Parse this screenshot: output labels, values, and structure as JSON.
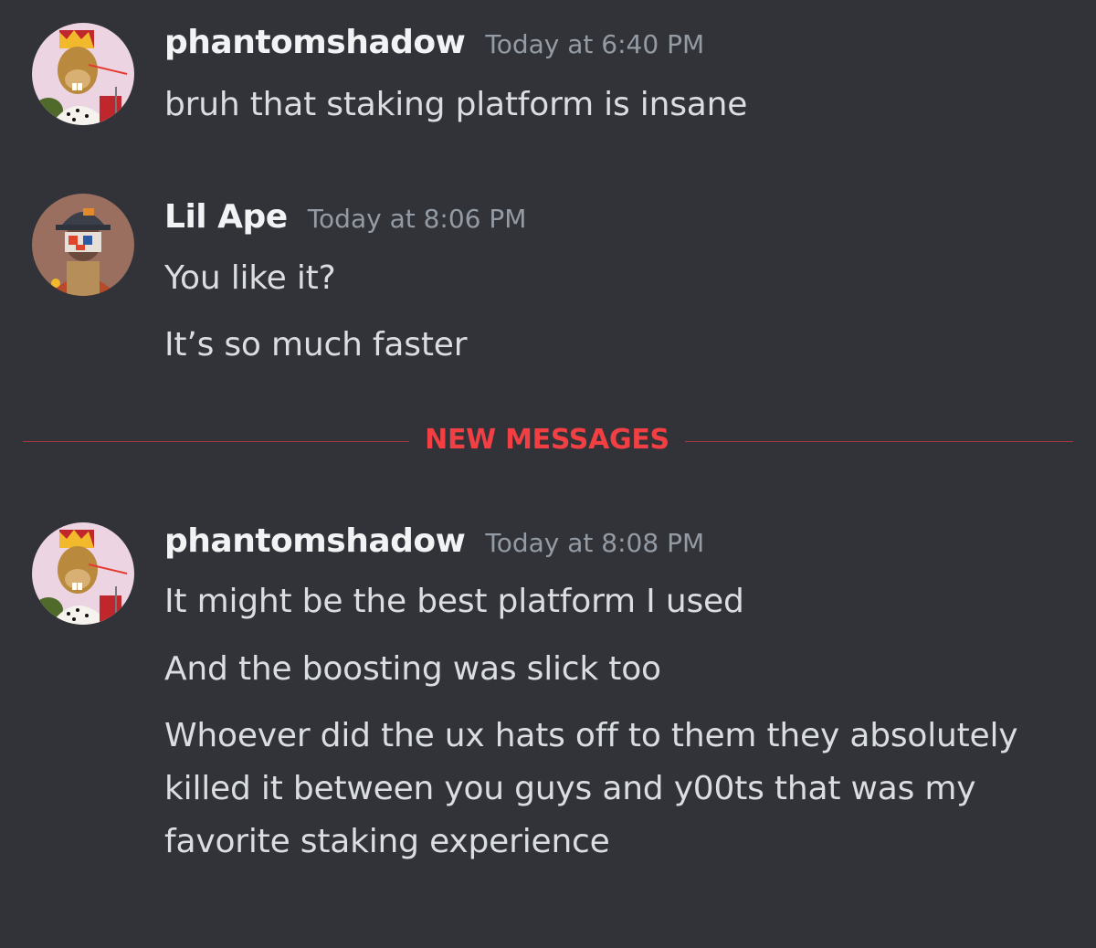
{
  "messages": [
    {
      "author": "phantomshadow",
      "timestamp": "Today at 6:40 PM",
      "avatar_icon": "crowned-beaver-avatar",
      "lines": [
        "bruh that staking platform is insane"
      ]
    },
    {
      "author": "Lil Ape",
      "timestamp": "Today at 8:06 PM",
      "avatar_icon": "masked-ape-avatar",
      "lines": [
        "You like it?",
        "It’s so much faster"
      ]
    }
  ],
  "divider": {
    "label": "NEW MESSAGES",
    "color": "#f23f43"
  },
  "new_messages": [
    {
      "author": "phantomshadow",
      "timestamp": "Today at 8:08 PM",
      "avatar_icon": "crowned-beaver-avatar",
      "lines": [
        "It might be the best platform I used",
        "And the boosting was slick too",
        "Whoever did the ux hats off to them they absolutely",
        "killed it between you guys and y00ts that was my",
        "favorite staking experience"
      ]
    }
  ],
  "colors": {
    "background": "#313338",
    "username": "#f2f3f5",
    "timestamp": "#949ba4",
    "message_text": "#dbdee1",
    "new_messages_accent": "#f23f43"
  }
}
